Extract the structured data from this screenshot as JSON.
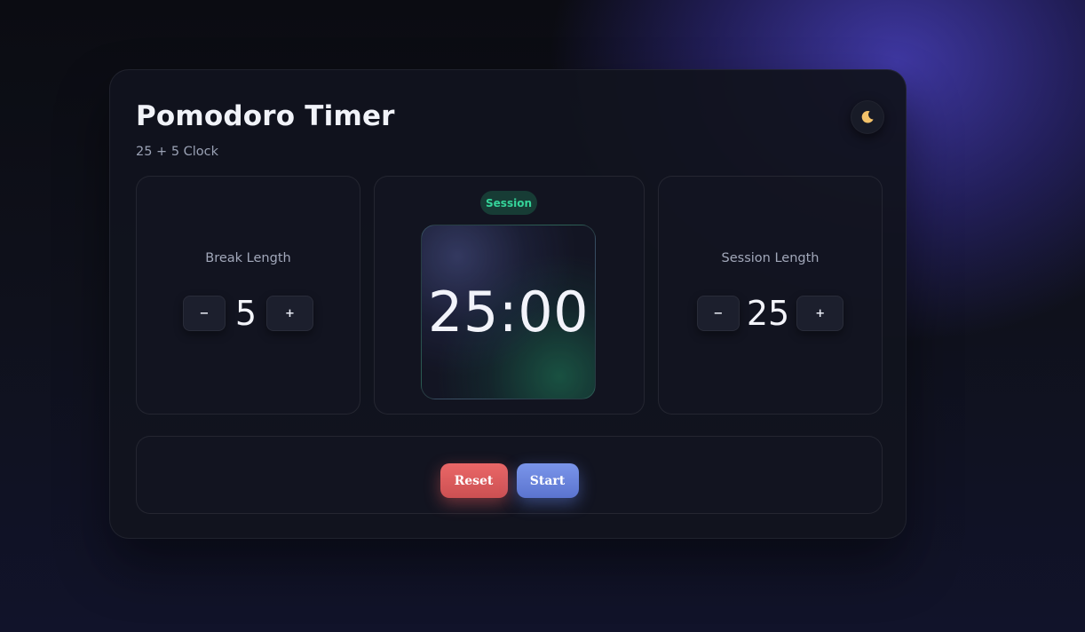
{
  "app": {
    "title": "Pomodoro Timer",
    "subtitle": "25 + 5 Clock"
  },
  "theme_toggle": {
    "icon": "moon-icon",
    "glyph": "🌙"
  },
  "break_panel": {
    "label": "Break Length",
    "decrement_label": "−",
    "value": "5",
    "increment_label": "+"
  },
  "timer": {
    "mode_badge": "Session",
    "time": "25:00"
  },
  "session_panel": {
    "label": "Session Length",
    "decrement_label": "−",
    "value": "25",
    "increment_label": "+"
  },
  "controls": {
    "reset_label": "Reset",
    "start_label": "Start"
  },
  "colors": {
    "accent_blue": "#6f89e3",
    "accent_red": "#dd5b5c",
    "session_green": "#35d59a",
    "background": "#0f111c"
  }
}
